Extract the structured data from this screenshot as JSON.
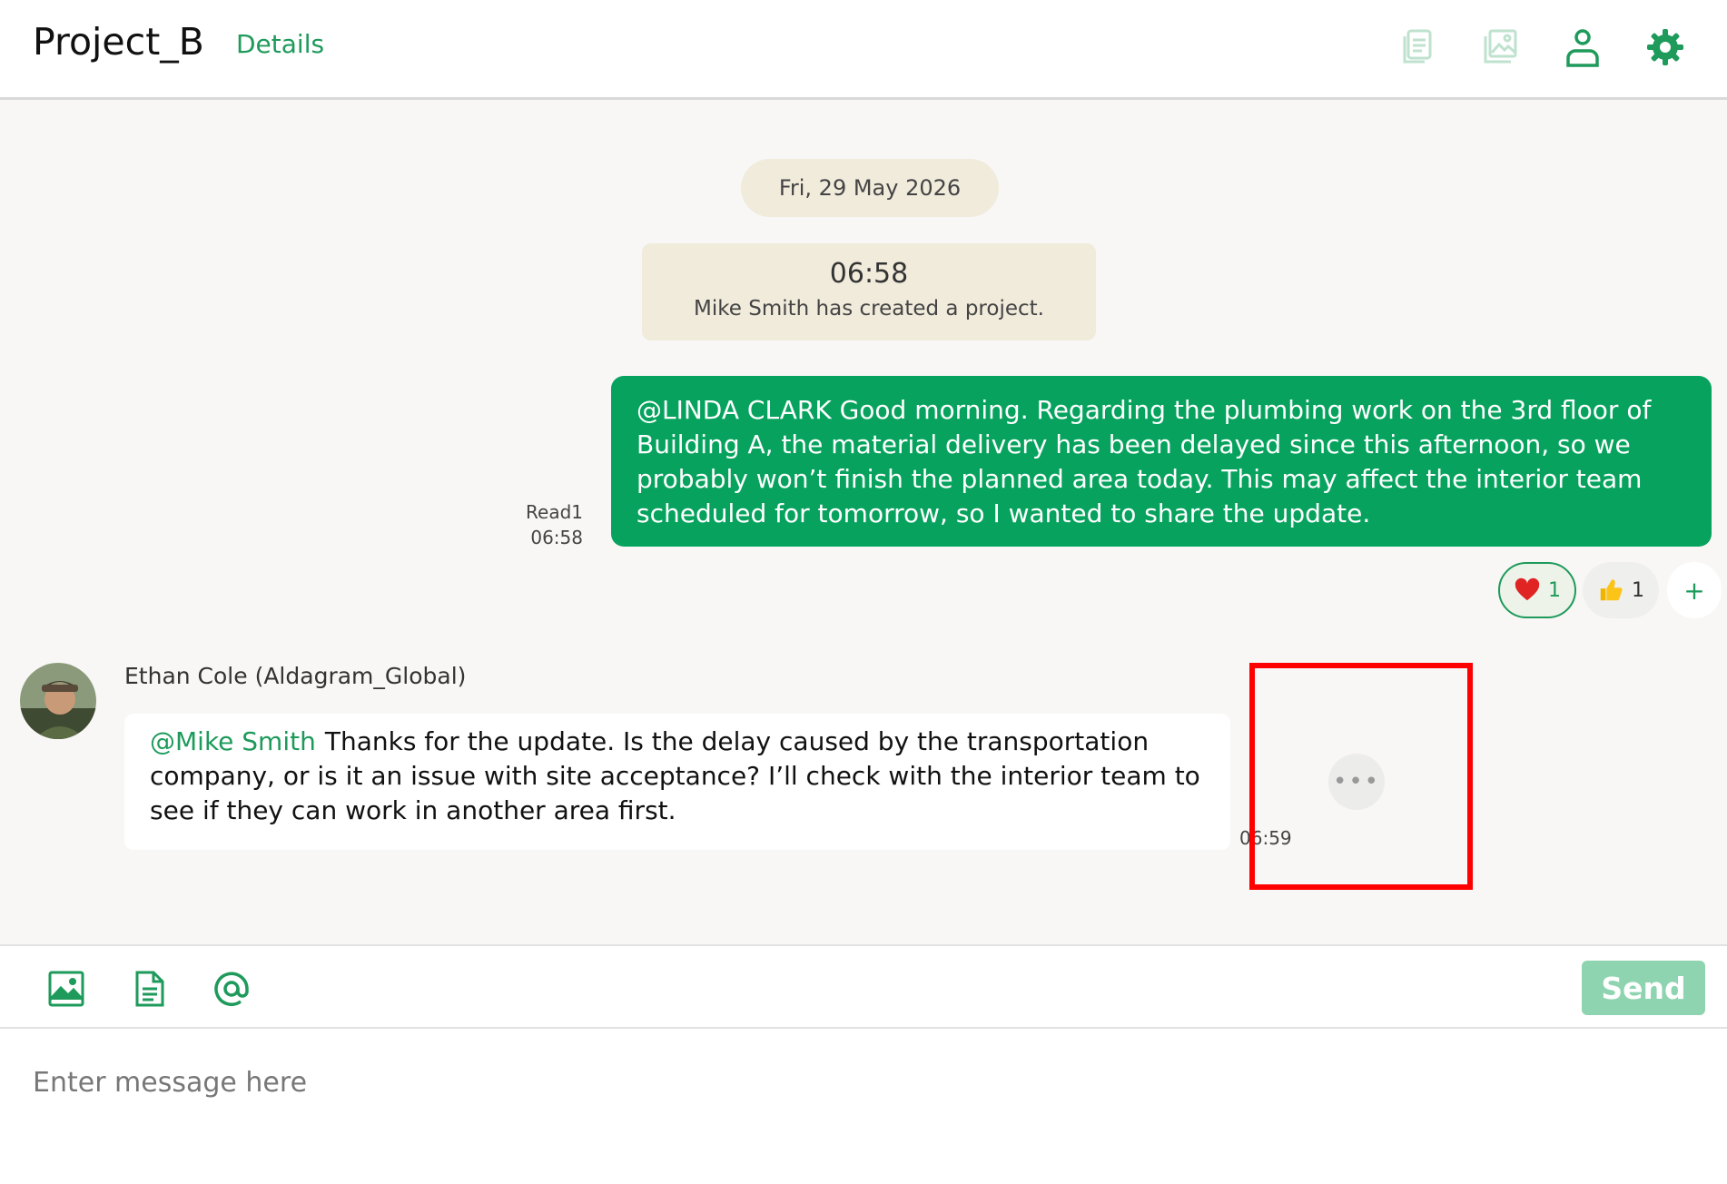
{
  "header": {
    "title": "Project_B",
    "details_link": "Details",
    "icons": [
      "files-icon",
      "images-icon",
      "members-icon",
      "settings-icon"
    ]
  },
  "chat": {
    "date_separator": "Fri, 29 May 2026",
    "system_message": {
      "time": "06:58",
      "text": "Mike Smith has created a project."
    },
    "outgoing_message": {
      "text": "@LINDA CLARK  Good morning. Regarding the plumbing work on the 3rd floor of Building A, the material delivery has been delayed since this afternoon, so we probably won’t finish the planned area today. This may affect the interior team scheduled for tomorrow, so I wanted to share the update.",
      "read_label": "Read1",
      "time": "06:58",
      "reactions": [
        {
          "emoji": "heart-icon",
          "count": "1",
          "active": true
        },
        {
          "emoji": "thumbs-up-icon",
          "count": "1",
          "active": false
        }
      ],
      "add_reaction_label": "+"
    },
    "incoming_message": {
      "sender": "Ethan Cole (Aldagram_Global)",
      "mention": "@Mike Smith",
      "text": "Thanks for the update. Is the delay caused by the transportation company, or is it an issue with site acceptance? I’ll check with the interior team to see if they can work in another area first.",
      "time": "06:59",
      "more_label": "•••"
    }
  },
  "composer": {
    "placeholder": "Enter message here",
    "send_label": "Send",
    "tools": [
      "image-icon",
      "file-icon",
      "mention-icon"
    ]
  },
  "colors": {
    "accent": "#1e9a5b",
    "outgoing_bubble": "#07a35e",
    "system_bg": "#f1ebdc",
    "highlight": "#ff0000"
  }
}
